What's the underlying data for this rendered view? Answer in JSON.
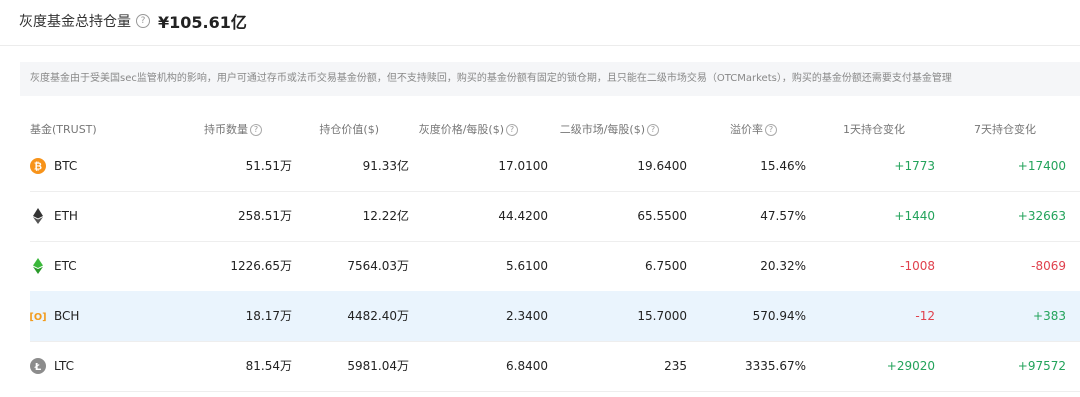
{
  "header": {
    "label": "灰度基金总持仓量",
    "help": "?",
    "total": "¥105.61亿"
  },
  "notice": "灰度基金由于受美国sec监管机构的影响，用户可通过存币或法币交易基金份额，但不支持赎回，购买的基金份额有固定的锁仓期，且只能在二级市场交易（OTCMarkets），购买的基金份额还需要支付基金管理",
  "columns": [
    "基金(TRUST)",
    "持币数量",
    "持仓价值($)",
    "灰度价格/每股($)",
    "二级市场/每股($)",
    "溢价率",
    "1天持仓变化",
    "7天持仓变化"
  ],
  "rows": [
    {
      "coin": "BTC",
      "holdings": "51.51万",
      "value": "91.33亿",
      "price": "17.0100",
      "secondary": "19.6400",
      "premium": "15.46%",
      "change1d": "+1773",
      "change7d": "+17400"
    },
    {
      "coin": "ETH",
      "holdings": "258.51万",
      "value": "12.22亿",
      "price": "44.4200",
      "secondary": "65.5500",
      "premium": "47.57%",
      "change1d": "+1440",
      "change7d": "+32663"
    },
    {
      "coin": "ETC",
      "holdings": "1226.65万",
      "value": "7564.03万",
      "price": "5.6100",
      "secondary": "6.7500",
      "premium": "20.32%",
      "change1d": "-1008",
      "change7d": "-8069"
    },
    {
      "coin": "BCH",
      "holdings": "18.17万",
      "value": "4482.40万",
      "price": "2.3400",
      "secondary": "15.7000",
      "premium": "570.94%",
      "change1d": "-12",
      "change7d": "+383"
    },
    {
      "coin": "LTC",
      "holdings": "81.54万",
      "value": "5981.04万",
      "price": "6.8400",
      "secondary": "235",
      "premium": "3335.67%",
      "change1d": "+29020",
      "change7d": "+97572"
    }
  ],
  "colors": {
    "positive": "#23a35b",
    "negative": "#e0414d",
    "btc": "#f7931a",
    "eth": "#333333",
    "etc": "#3ab83a",
    "bch": "#f29b1d",
    "ltc": "#8c8c8c",
    "highlight_row": "#eaf4fd"
  },
  "icons": {
    "btc": "bitcoin-icon",
    "eth": "ethereum-icon",
    "etc": "ethereum-classic-icon",
    "bch": "bitcoin-cash-icon",
    "ltc": "litecoin-icon"
  }
}
